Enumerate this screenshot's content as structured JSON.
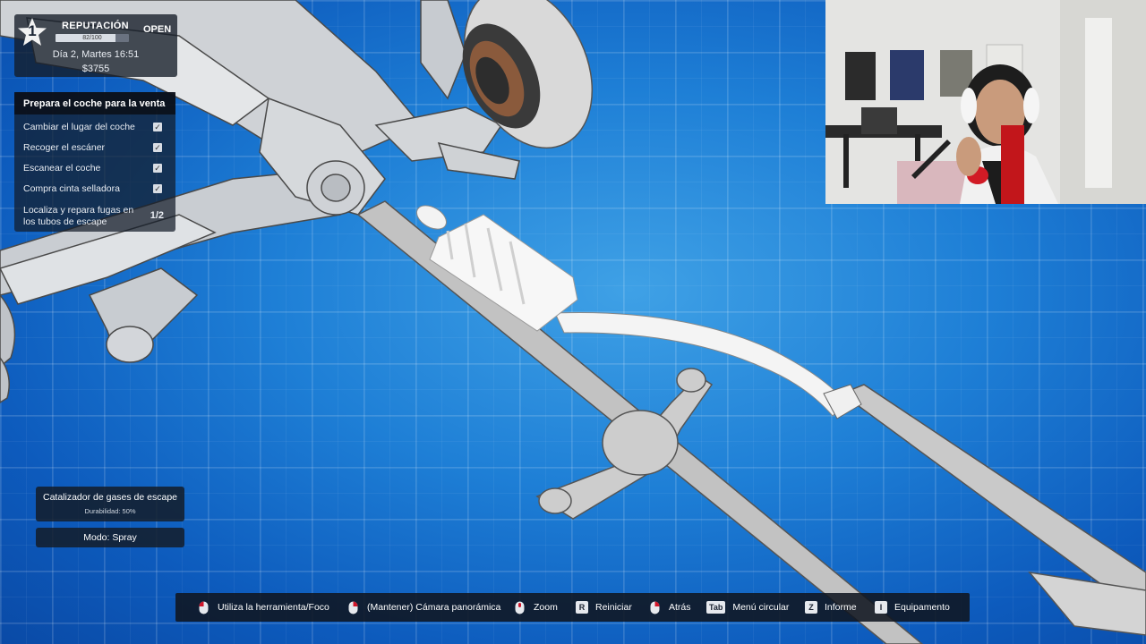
{
  "hud": {
    "level": "1",
    "reputation_title": "REPUTACIÓN",
    "reputation_value": "82/100",
    "reputation_fraction": 0.82,
    "open_badge": "OPEN",
    "day_time": "Día 2, Martes 16:51",
    "money": "$3755"
  },
  "tasks": {
    "title": "Prepara el coche para la venta",
    "items": [
      {
        "label": "Cambiar el lugar del coche",
        "checked": true
      },
      {
        "label": "Recoger el escáner",
        "checked": true
      },
      {
        "label": "Escanear el coche",
        "checked": true
      },
      {
        "label": "Compra cinta selladora",
        "checked": true
      },
      {
        "label_line1": "Localiza y repara fugas en",
        "label_line2": "los tubos de escape",
        "progress": "1/2"
      }
    ]
  },
  "part": {
    "name": "Catalizador de gases de escape",
    "durability": "Durabilidad: 50%"
  },
  "mode": "Modo: Spray",
  "controls": [
    {
      "key": "mouse-left",
      "label": "Utiliza la herramienta/Foco"
    },
    {
      "key": "mouse-right",
      "label": "(Mantener)  Cámara panorámica"
    },
    {
      "key": "mouse-scroll",
      "label": "Zoom"
    },
    {
      "key": "R",
      "label": "Reiniciar"
    },
    {
      "key": "mouse-right",
      "label": "Atrás"
    },
    {
      "key": "Tab",
      "label": "Menú circular"
    },
    {
      "key": "Z",
      "label": "Informe"
    },
    {
      "key": "I",
      "label": "Equipamento"
    }
  ],
  "colors": {
    "background": "#1e7fd6",
    "panel": "#141c28",
    "part_white": "#f2f2f2",
    "pipe_gray": "#cfcfcf"
  }
}
